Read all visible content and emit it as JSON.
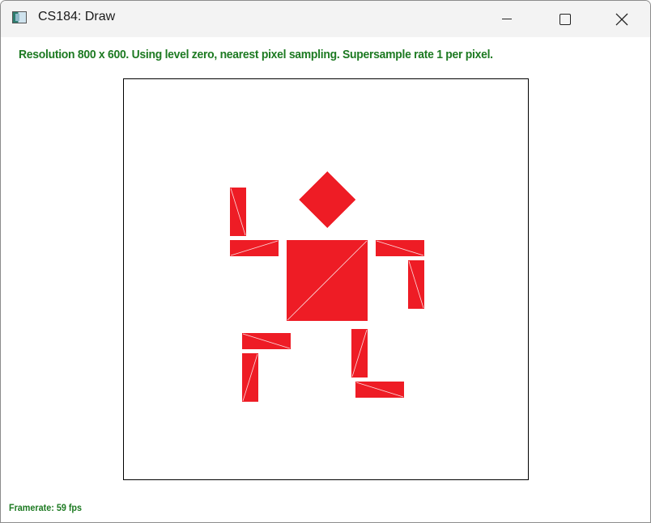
{
  "window": {
    "title": "CS184: Draw",
    "app_icon": "app-window-icon",
    "controls": [
      "minimize-icon",
      "maximize-icon",
      "close-icon"
    ]
  },
  "status_text": "Resolution 800 x 600. Using level zero, nearest pixel sampling. Supersample rate 1 per pixel.",
  "framerate_text": "Framerate: 59 fps",
  "colors": {
    "status_text": "#1d7a22",
    "shape_fill": "#ee1c25"
  }
}
